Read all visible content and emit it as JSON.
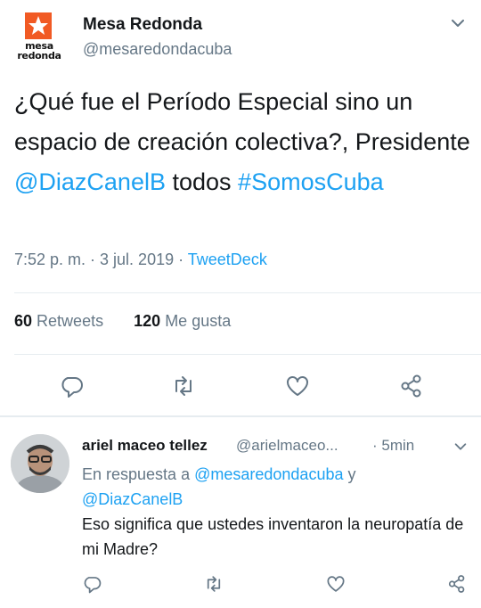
{
  "tweet": {
    "display_name": "Mesa Redonda",
    "handle": "@mesaredondacuba",
    "logo_text_line1": "mesa",
    "logo_text_line2": "redonda",
    "text_part1": "¿Qué fue el Período Especial sino un espacio de creación colectiva?, Presidente ",
    "mention": "@DiazCanelB",
    "text_part2": " todos ",
    "hashtag": "#SomosCuba",
    "time": "7:52 p. m. · 3 jul. 2019 · ",
    "source": "TweetDeck",
    "retweets_count": "60",
    "retweets_label": "Retweets",
    "likes_count": "120",
    "likes_label": "Me gusta"
  },
  "reply": {
    "name": "ariel maceo tellez",
    "handle": "@arielmaceo...",
    "time": "· 5min",
    "replying_prefix": "En respuesta a ",
    "replying_to1": "@mesaredondacuba",
    "replying_and": " y",
    "replying_to2": "@DiazCanelB",
    "text": "Eso significa que ustedes inventaron la neuropatía de mi Madre?"
  },
  "icons": {
    "reply": "reply-icon",
    "retweet": "retweet-icon",
    "like": "heart-icon",
    "share": "share-icon",
    "menu": "chevron-down-icon"
  },
  "colors": {
    "link": "#1da1f2",
    "secondary_text": "#657786",
    "brand_orange": "#f15a24",
    "icon_gray": "#657786"
  }
}
